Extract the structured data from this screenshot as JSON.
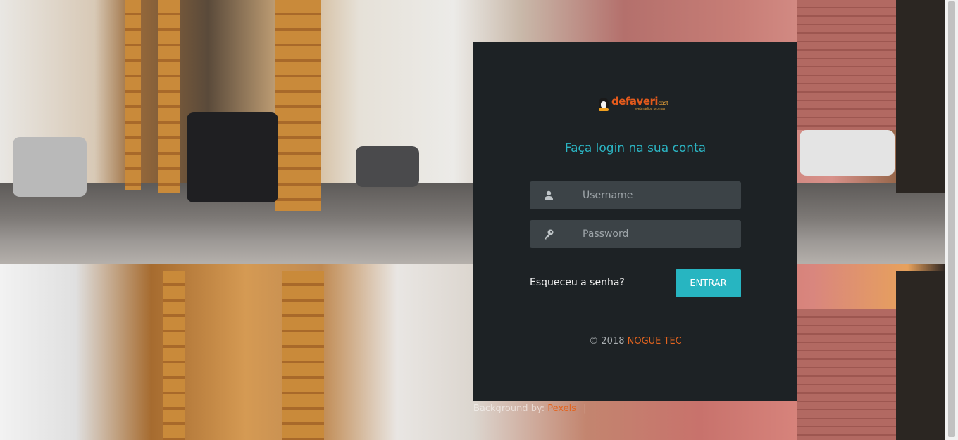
{
  "logo": {
    "brand": "defaveri",
    "brand_suffix": "cast",
    "tagline": "web rádios prontas"
  },
  "login": {
    "title": "Faça login na sua conta",
    "username": {
      "placeholder": "Username",
      "icon": "user-icon"
    },
    "password": {
      "placeholder": "Password",
      "icon": "key-icon"
    },
    "forgot_label": "Esqueceu a senha?",
    "submit_label": "ENTRAR"
  },
  "footer": {
    "copyright": "© 2018",
    "company": "NOGUE TEC"
  },
  "background_credit": {
    "label": "Background by:",
    "link": "Pexels",
    "separator": "|"
  },
  "colors": {
    "panel": "#1d2225",
    "accent": "#27b5c1",
    "brand": "#e2641f",
    "field": "#3c4347"
  }
}
